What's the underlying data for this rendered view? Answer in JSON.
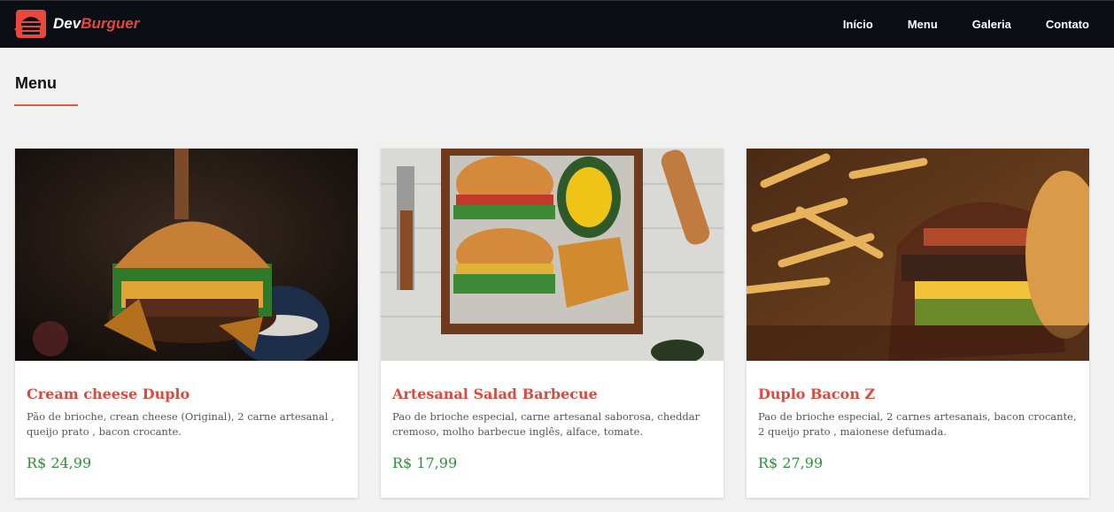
{
  "header": {
    "brand_prefix": "Dev",
    "brand_suffix": "Burguer",
    "nav": [
      {
        "label": "Início"
      },
      {
        "label": "Menu"
      },
      {
        "label": "Galeria"
      },
      {
        "label": "Contato"
      }
    ]
  },
  "section": {
    "title": "Menu"
  },
  "menu_items": [
    {
      "name": "Cream cheese Duplo",
      "description": "Pão de brioche, crean cheese (Original), 2 carne artesanal , queijo prato , bacon crocante.",
      "price": "R$ 24,99"
    },
    {
      "name": "Artesanal Salad Barbecue",
      "description": "Pao de brioche especial, carne artesanal saborosa, cheddar cremoso, molho barbecue inglês, alface, tomate.",
      "price": "R$ 17,99"
    },
    {
      "name": "Duplo Bacon Z",
      "description": "Pao de brioche especial, 2 carnes artesanais, bacon crocante, 2 queijo prato , maionese defumada.",
      "price": "R$ 27,99"
    }
  ],
  "colors": {
    "accent": "#e8473c",
    "navbar": "#0b0e14",
    "price": "#2f8f3a",
    "background": "#f1f1f1"
  },
  "icons": {
    "logo": "burger-icon"
  }
}
